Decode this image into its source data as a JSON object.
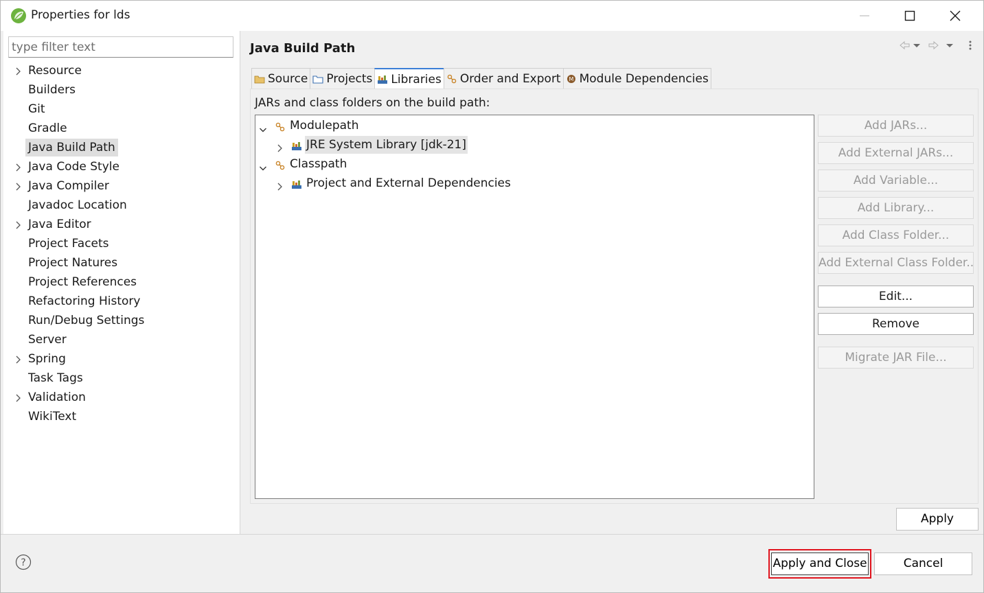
{
  "window": {
    "title": "Properties for lds",
    "app_icon": "spring-leaf-icon",
    "controls": [
      "minimize-icon",
      "maximize-icon",
      "close-icon"
    ]
  },
  "filter": {
    "placeholder": "type filter text",
    "value": ""
  },
  "nav": {
    "items": [
      {
        "label": "Resource",
        "expandable": true
      },
      {
        "label": "Builders",
        "expandable": false
      },
      {
        "label": "Git",
        "expandable": false
      },
      {
        "label": "Gradle",
        "expandable": false
      },
      {
        "label": "Java Build Path",
        "expandable": false,
        "selected": true
      },
      {
        "label": "Java Code Style",
        "expandable": true
      },
      {
        "label": "Java Compiler",
        "expandable": true
      },
      {
        "label": "Javadoc Location",
        "expandable": false
      },
      {
        "label": "Java Editor",
        "expandable": true
      },
      {
        "label": "Project Facets",
        "expandable": false
      },
      {
        "label": "Project Natures",
        "expandable": false
      },
      {
        "label": "Project References",
        "expandable": false
      },
      {
        "label": "Refactoring History",
        "expandable": false
      },
      {
        "label": "Run/Debug Settings",
        "expandable": false
      },
      {
        "label": "Server",
        "expandable": false
      },
      {
        "label": "Spring",
        "expandable": true
      },
      {
        "label": "Task Tags",
        "expandable": false
      },
      {
        "label": "Validation",
        "expandable": true
      },
      {
        "label": "WikiText",
        "expandable": false
      }
    ]
  },
  "page": {
    "title": "Java Build Path",
    "tabs": [
      {
        "label": "Source",
        "icon": "source-folder-icon"
      },
      {
        "label": "Projects",
        "icon": "projects-icon"
      },
      {
        "label": "Libraries",
        "icon": "library-icon",
        "active": true
      },
      {
        "label": "Order and Export",
        "icon": "order-export-icon"
      },
      {
        "label": "Module Dependencies",
        "icon": "module-icon"
      }
    ],
    "description": "JARs and class folders on the build path:",
    "tree": [
      {
        "label": "Modulepath",
        "level": 0,
        "expanded": true,
        "icon": "path-icon"
      },
      {
        "label": "JRE System Library [jdk-21]",
        "level": 1,
        "expanded": false,
        "icon": "library-icon",
        "selected": true
      },
      {
        "label": "Classpath",
        "level": 0,
        "expanded": true,
        "icon": "path-icon"
      },
      {
        "label": "Project and External Dependencies",
        "level": 1,
        "expanded": false,
        "icon": "library-icon"
      }
    ],
    "buttons": [
      {
        "label": "Add JARs...",
        "enabled": false
      },
      {
        "label": "Add External JARs...",
        "enabled": false
      },
      {
        "label": "Add Variable...",
        "enabled": false
      },
      {
        "label": "Add Library...",
        "enabled": false
      },
      {
        "label": "Add Class Folder...",
        "enabled": false
      },
      {
        "label": "Add External Class Folder...",
        "enabled": false
      },
      {
        "label": "Edit...",
        "enabled": true
      },
      {
        "label": "Remove",
        "enabled": true
      },
      {
        "label": "Migrate JAR File...",
        "enabled": false
      }
    ],
    "apply_label": "Apply"
  },
  "footer": {
    "apply_close_label": "Apply and Close",
    "cancel_label": "Cancel",
    "highlight_color": "#e0141e"
  }
}
